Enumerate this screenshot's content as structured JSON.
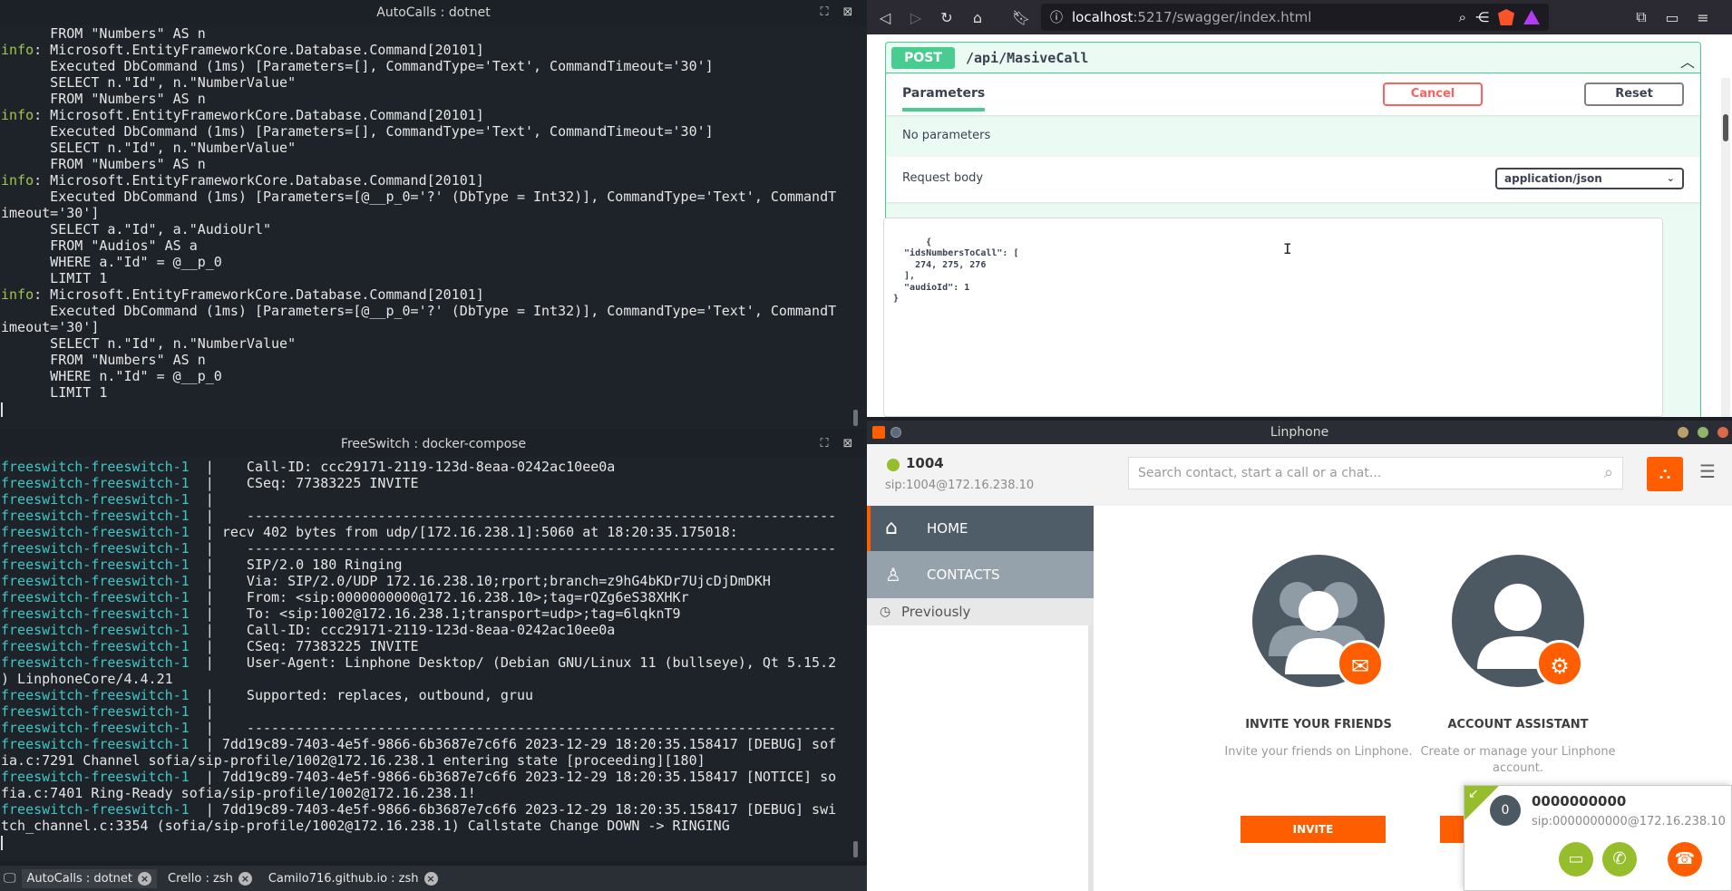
{
  "terminal_top": {
    "title": "AutoCalls : dotnet",
    "lines": [
      {
        "t": "      FROM \"Numbers\" AS n"
      },
      {
        "p": "info",
        "t": ": Microsoft.EntityFrameworkCore.Database.Command[20101]"
      },
      {
        "t": "      Executed DbCommand (1ms) [Parameters=[], CommandType='Text', CommandTimeout='30']"
      },
      {
        "t": "      SELECT n.\"Id\", n.\"NumberValue\""
      },
      {
        "t": "      FROM \"Numbers\" AS n"
      },
      {
        "p": "info",
        "t": ": Microsoft.EntityFrameworkCore.Database.Command[20101]"
      },
      {
        "t": "      Executed DbCommand (1ms) [Parameters=[], CommandType='Text', CommandTimeout='30']"
      },
      {
        "t": "      SELECT n.\"Id\", n.\"NumberValue\""
      },
      {
        "t": "      FROM \"Numbers\" AS n"
      },
      {
        "p": "info",
        "t": ": Microsoft.EntityFrameworkCore.Database.Command[20101]"
      },
      {
        "t": "      Executed DbCommand (1ms) [Parameters=[@__p_0='?' (DbType = Int32)], CommandType='Text', CommandT"
      },
      {
        "t": "imeout='30']"
      },
      {
        "t": "      SELECT a.\"Id\", a.\"AudioUrl\""
      },
      {
        "t": "      FROM \"Audios\" AS a"
      },
      {
        "t": "      WHERE a.\"Id\" = @__p_0"
      },
      {
        "t": "      LIMIT 1"
      },
      {
        "p": "info",
        "t": ": Microsoft.EntityFrameworkCore.Database.Command[20101]"
      },
      {
        "t": "      Executed DbCommand (1ms) [Parameters=[@__p_0='?' (DbType = Int32)], CommandType='Text', CommandT"
      },
      {
        "t": "imeout='30']"
      },
      {
        "t": "      SELECT n.\"Id\", n.\"NumberValue\""
      },
      {
        "t": "      FROM \"Numbers\" AS n"
      },
      {
        "t": "      WHERE n.\"Id\" = @__p_0"
      },
      {
        "t": "      LIMIT 1"
      }
    ]
  },
  "terminal_bottom": {
    "title": "FreeSwitch : docker-compose",
    "lines": [
      {
        "p": "freeswitch-freeswitch-1",
        "t": "  |    Call-ID: ccc29171-2119-123d-8eaa-0242ac10ee0a"
      },
      {
        "p": "freeswitch-freeswitch-1",
        "t": "  |    CSeq: 77383225 INVITE"
      },
      {
        "p": "freeswitch-freeswitch-1",
        "t": "  |"
      },
      {
        "p": "freeswitch-freeswitch-1",
        "t": "  |    ------------------------------------------------------------------------"
      },
      {
        "p": "freeswitch-freeswitch-1",
        "t": "  | recv 402 bytes from udp/[172.16.238.1]:5060 at 18:20:35.175018:"
      },
      {
        "p": "freeswitch-freeswitch-1",
        "t": "  |    ------------------------------------------------------------------------"
      },
      {
        "p": "freeswitch-freeswitch-1",
        "t": "  |    SIP/2.0 180 Ringing"
      },
      {
        "p": "freeswitch-freeswitch-1",
        "t": "  |    Via: SIP/2.0/UDP 172.16.238.10;rport;branch=z9hG4bKDr7UjcDjDmDKH"
      },
      {
        "p": "freeswitch-freeswitch-1",
        "t": "  |    From: <sip:0000000000@172.16.238.10>;tag=rQZg6eS38XHKr"
      },
      {
        "p": "freeswitch-freeswitch-1",
        "t": "  |    To: <sip:1002@172.16.238.1;transport=udp>;tag=6lqknT9"
      },
      {
        "p": "freeswitch-freeswitch-1",
        "t": "  |    Call-ID: ccc29171-2119-123d-8eaa-0242ac10ee0a"
      },
      {
        "p": "freeswitch-freeswitch-1",
        "t": "  |    CSeq: 77383225 INVITE"
      },
      {
        "p": "freeswitch-freeswitch-1",
        "t": "  |    User-Agent: Linphone Desktop/ (Debian GNU/Linux 11 (bullseye), Qt 5.15.2"
      },
      {
        "t": ") LinphoneCore/4.4.21"
      },
      {
        "p": "freeswitch-freeswitch-1",
        "t": "  |    Supported: replaces, outbound, gruu"
      },
      {
        "p": "freeswitch-freeswitch-1",
        "t": "  |"
      },
      {
        "p": "freeswitch-freeswitch-1",
        "t": "  |    ------------------------------------------------------------------------"
      },
      {
        "p": "freeswitch-freeswitch-1",
        "t": "  | 7dd19c89-7403-4e5f-9866-6b3687e7c6f6 2023-12-29 18:20:35.158417 [DEBUG] sof"
      },
      {
        "t": "ia.c:7291 Channel sofia/sip-profile/1002@172.16.238.1 entering state [proceeding][180]"
      },
      {
        "p": "freeswitch-freeswitch-1",
        "t": "  | 7dd19c89-7403-4e5f-9866-6b3687e7c6f6 2023-12-29 18:20:35.158417 [NOTICE] so"
      },
      {
        "t": "fia.c:7401 Ring-Ready sofia/sip-profile/1002@172.16.238.1!"
      },
      {
        "p": "freeswitch-freeswitch-1",
        "t": "  | 7dd19c89-7403-4e5f-9866-6b3687e7c6f6 2023-12-29 18:20:35.158417 [DEBUG] swi"
      },
      {
        "t": "tch_channel.c:3354 (sofia/sip-profile/1002@172.16.238.1) Callstate Change DOWN -> RINGING"
      }
    ]
  },
  "tabs": [
    {
      "label": "AutoCalls : dotnet"
    },
    {
      "label": "Crello : zsh"
    },
    {
      "label": "Camilo716.github.io : zsh"
    }
  ],
  "browser": {
    "url_host": "localhost",
    "url_path": ":5217/swagger/index.html",
    "method": "POST",
    "path": "/api/MasiveCall",
    "params_tab": "Parameters",
    "cancel": "Cancel",
    "reset": "Reset",
    "no_params": "No parameters",
    "request_body": "Request body",
    "content_type": "application/json",
    "body_json": "{\n  \"idsNumbersToCall\": [\n    274, 275, 276\n  ],\n  \"audioId\": 1\n}"
  },
  "linphone": {
    "title": "Linphone",
    "user": "1004",
    "sip": "sip:1004@172.16.238.10",
    "search_placeholder": "Search contact, start a call or a chat...",
    "nav_home": "HOME",
    "nav_contacts": "CONTACTS",
    "previously": "Previously",
    "invite_title": "INVITE YOUR FRIENDS",
    "invite_desc": "Invite your friends on Linphone.",
    "invite_btn": "INVITE",
    "assistant_title": "ACCOUNT ASSISTANT",
    "assistant_desc": "Create or manage your Linphone account.",
    "call": {
      "avatar_letter": "0",
      "number": "0000000000",
      "sip": "sip:0000000000@172.16.238.10"
    }
  },
  "colors": {
    "swagger_post": "#49cc90",
    "linphone_orange": "#ff5e00",
    "status_green": "#96be2c"
  }
}
